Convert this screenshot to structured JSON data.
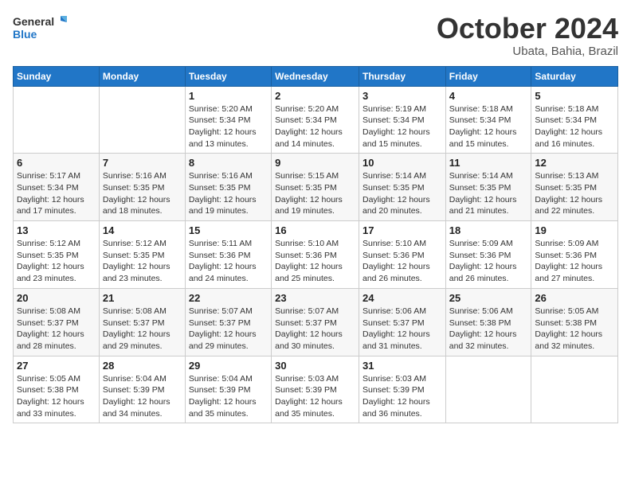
{
  "logo": {
    "line1": "General",
    "line2": "Blue"
  },
  "title": "October 2024",
  "subtitle": "Ubata, Bahia, Brazil",
  "days_of_week": [
    "Sunday",
    "Monday",
    "Tuesday",
    "Wednesday",
    "Thursday",
    "Friday",
    "Saturday"
  ],
  "weeks": [
    [
      {
        "day": "",
        "detail": ""
      },
      {
        "day": "",
        "detail": ""
      },
      {
        "day": "1",
        "detail": "Sunrise: 5:20 AM\nSunset: 5:34 PM\nDaylight: 12 hours and 13 minutes."
      },
      {
        "day": "2",
        "detail": "Sunrise: 5:20 AM\nSunset: 5:34 PM\nDaylight: 12 hours and 14 minutes."
      },
      {
        "day": "3",
        "detail": "Sunrise: 5:19 AM\nSunset: 5:34 PM\nDaylight: 12 hours and 15 minutes."
      },
      {
        "day": "4",
        "detail": "Sunrise: 5:18 AM\nSunset: 5:34 PM\nDaylight: 12 hours and 15 minutes."
      },
      {
        "day": "5",
        "detail": "Sunrise: 5:18 AM\nSunset: 5:34 PM\nDaylight: 12 hours and 16 minutes."
      }
    ],
    [
      {
        "day": "6",
        "detail": "Sunrise: 5:17 AM\nSunset: 5:34 PM\nDaylight: 12 hours and 17 minutes."
      },
      {
        "day": "7",
        "detail": "Sunrise: 5:16 AM\nSunset: 5:35 PM\nDaylight: 12 hours and 18 minutes."
      },
      {
        "day": "8",
        "detail": "Sunrise: 5:16 AM\nSunset: 5:35 PM\nDaylight: 12 hours and 19 minutes."
      },
      {
        "day": "9",
        "detail": "Sunrise: 5:15 AM\nSunset: 5:35 PM\nDaylight: 12 hours and 19 minutes."
      },
      {
        "day": "10",
        "detail": "Sunrise: 5:14 AM\nSunset: 5:35 PM\nDaylight: 12 hours and 20 minutes."
      },
      {
        "day": "11",
        "detail": "Sunrise: 5:14 AM\nSunset: 5:35 PM\nDaylight: 12 hours and 21 minutes."
      },
      {
        "day": "12",
        "detail": "Sunrise: 5:13 AM\nSunset: 5:35 PM\nDaylight: 12 hours and 22 minutes."
      }
    ],
    [
      {
        "day": "13",
        "detail": "Sunrise: 5:12 AM\nSunset: 5:35 PM\nDaylight: 12 hours and 23 minutes."
      },
      {
        "day": "14",
        "detail": "Sunrise: 5:12 AM\nSunset: 5:35 PM\nDaylight: 12 hours and 23 minutes."
      },
      {
        "day": "15",
        "detail": "Sunrise: 5:11 AM\nSunset: 5:36 PM\nDaylight: 12 hours and 24 minutes."
      },
      {
        "day": "16",
        "detail": "Sunrise: 5:10 AM\nSunset: 5:36 PM\nDaylight: 12 hours and 25 minutes."
      },
      {
        "day": "17",
        "detail": "Sunrise: 5:10 AM\nSunset: 5:36 PM\nDaylight: 12 hours and 26 minutes."
      },
      {
        "day": "18",
        "detail": "Sunrise: 5:09 AM\nSunset: 5:36 PM\nDaylight: 12 hours and 26 minutes."
      },
      {
        "day": "19",
        "detail": "Sunrise: 5:09 AM\nSunset: 5:36 PM\nDaylight: 12 hours and 27 minutes."
      }
    ],
    [
      {
        "day": "20",
        "detail": "Sunrise: 5:08 AM\nSunset: 5:37 PM\nDaylight: 12 hours and 28 minutes."
      },
      {
        "day": "21",
        "detail": "Sunrise: 5:08 AM\nSunset: 5:37 PM\nDaylight: 12 hours and 29 minutes."
      },
      {
        "day": "22",
        "detail": "Sunrise: 5:07 AM\nSunset: 5:37 PM\nDaylight: 12 hours and 29 minutes."
      },
      {
        "day": "23",
        "detail": "Sunrise: 5:07 AM\nSunset: 5:37 PM\nDaylight: 12 hours and 30 minutes."
      },
      {
        "day": "24",
        "detail": "Sunrise: 5:06 AM\nSunset: 5:37 PM\nDaylight: 12 hours and 31 minutes."
      },
      {
        "day": "25",
        "detail": "Sunrise: 5:06 AM\nSunset: 5:38 PM\nDaylight: 12 hours and 32 minutes."
      },
      {
        "day": "26",
        "detail": "Sunrise: 5:05 AM\nSunset: 5:38 PM\nDaylight: 12 hours and 32 minutes."
      }
    ],
    [
      {
        "day": "27",
        "detail": "Sunrise: 5:05 AM\nSunset: 5:38 PM\nDaylight: 12 hours and 33 minutes."
      },
      {
        "day": "28",
        "detail": "Sunrise: 5:04 AM\nSunset: 5:39 PM\nDaylight: 12 hours and 34 minutes."
      },
      {
        "day": "29",
        "detail": "Sunrise: 5:04 AM\nSunset: 5:39 PM\nDaylight: 12 hours and 35 minutes."
      },
      {
        "day": "30",
        "detail": "Sunrise: 5:03 AM\nSunset: 5:39 PM\nDaylight: 12 hours and 35 minutes."
      },
      {
        "day": "31",
        "detail": "Sunrise: 5:03 AM\nSunset: 5:39 PM\nDaylight: 12 hours and 36 minutes."
      },
      {
        "day": "",
        "detail": ""
      },
      {
        "day": "",
        "detail": ""
      }
    ]
  ]
}
